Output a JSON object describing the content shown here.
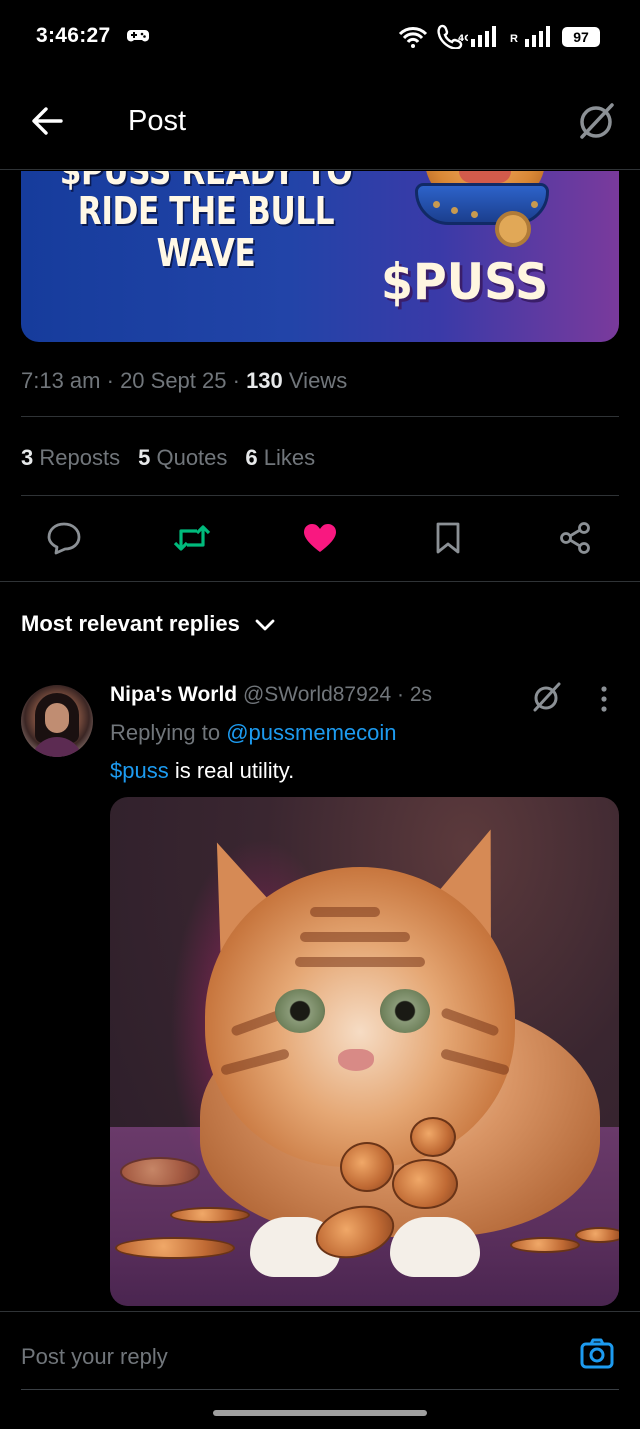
{
  "status_bar": {
    "time": "3:46:27",
    "signal_roaming_label": "R",
    "battery": "97"
  },
  "header": {
    "title": "Post"
  },
  "banner": {
    "line_cut": "$PUSS READY TO",
    "line2": "RIDE THE BULL",
    "line3": "WAVE",
    "brand": "$PUSS"
  },
  "post_meta": {
    "time": "7:13 am",
    "date": "20 Sept 25",
    "views_count": "130",
    "views_label": "Views"
  },
  "stats": {
    "reposts_count": "3",
    "reposts_label": "Reposts",
    "quotes_count": "5",
    "quotes_label": "Quotes",
    "likes_count": "6",
    "likes_label": "Likes"
  },
  "actions": {
    "liked": true,
    "reposted": true,
    "like_color": "#f91880",
    "repost_color": "#00ba7c"
  },
  "replies_sort": {
    "label": "Most relevant replies"
  },
  "reply": {
    "name": "Nipa's World",
    "handle": "@SWorld87924",
    "time": "2s",
    "replying_prefix": "Replying to",
    "replying_to": "@pussmemecoin",
    "cashtag": "$puss",
    "text_rest": " is real utility."
  },
  "composer": {
    "placeholder": "Post your reply"
  },
  "icons": [
    "game-icon",
    "wifi-icon",
    "call-icon",
    "signal-icon",
    "battery-icon",
    "back-arrow-icon",
    "grok-icon",
    "reply-icon",
    "repost-icon",
    "like-icon",
    "bookmark-icon",
    "share-icon",
    "chevron-down-icon",
    "more-icon",
    "camera-icon"
  ]
}
